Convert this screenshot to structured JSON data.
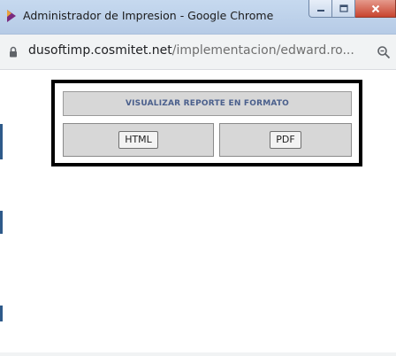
{
  "window": {
    "title": "Administrador de Impresion - Google Chrome",
    "controls": {
      "minimize_icon": "minimize-icon",
      "maximize_icon": "maximize-icon",
      "close_icon": "close-icon"
    }
  },
  "addressbar": {
    "url_host": "dusoftimp.cosmitet.net",
    "url_path": "/implementacion/edward.ro...",
    "lock_icon": "lock-icon",
    "zoom_icon": "zoom-icon"
  },
  "report": {
    "header": "VISUALIZAR REPORTE EN FORMATO",
    "html_button": "HTML",
    "pdf_button": "PDF"
  },
  "colors": {
    "titlebar": "#c6d9ef",
    "close_button": "#c8442f",
    "header_text": "#4a5f8c",
    "panel_border": "#000000",
    "cell_background": "#d7d7d7"
  }
}
